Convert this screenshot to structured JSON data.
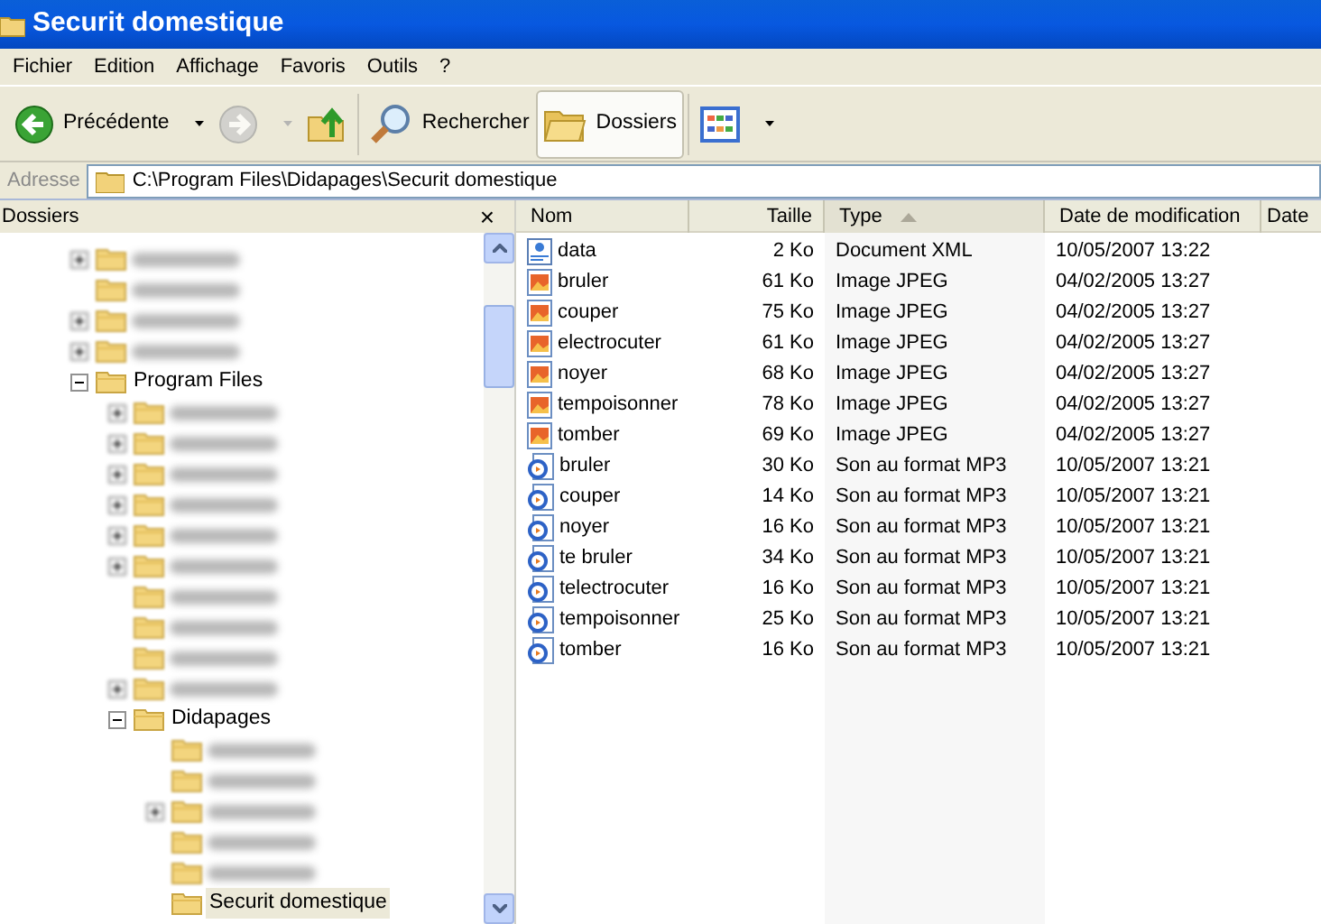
{
  "window": {
    "title": "Securit domestique"
  },
  "menu": [
    "Fichier",
    "Edition",
    "Affichage",
    "Favoris",
    "Outils",
    "?"
  ],
  "toolbar": [
    {
      "kind": "back",
      "label": "Précédente",
      "disabled": false
    },
    {
      "kind": "forward",
      "disabled": true
    },
    {
      "kind": "up"
    },
    {
      "kind": "search",
      "label": "Rechercher",
      "selected": false
    },
    {
      "kind": "folders",
      "label": "Dossiers",
      "selected": true
    },
    {
      "kind": "views"
    }
  ],
  "address": {
    "label": "Adresse",
    "value": "C:\\Program Files\\Didapages\\Securit domestique"
  },
  "folders_pane": {
    "title": "Dossiers",
    "close": "×"
  },
  "tree": [
    {
      "redacted": true,
      "expandable": true,
      "expanded": false,
      "selected": false
    },
    {
      "redacted": true,
      "expandable": false,
      "expanded": false,
      "selected": false
    },
    {
      "redacted": true,
      "expandable": true,
      "expanded": false,
      "selected": false
    },
    {
      "redacted": true,
      "expandable": true,
      "expanded": false,
      "selected": false
    },
    {
      "label": "Program Files",
      "expandable": true,
      "expanded": true,
      "selected": false,
      "children": [
        {
          "redacted": true,
          "expandable": true,
          "expanded": false,
          "selected": false
        },
        {
          "redacted": true,
          "expandable": true,
          "expanded": false,
          "selected": false
        },
        {
          "redacted": true,
          "expandable": true,
          "expanded": false,
          "selected": false
        },
        {
          "redacted": true,
          "expandable": true,
          "expanded": false,
          "selected": false
        },
        {
          "redacted": true,
          "expandable": true,
          "expanded": false,
          "selected": false
        },
        {
          "redacted": true,
          "expandable": true,
          "expanded": false,
          "selected": false
        },
        {
          "redacted": true,
          "expandable": false,
          "expanded": false,
          "selected": false
        },
        {
          "redacted": true,
          "expandable": false,
          "expanded": false,
          "selected": false
        },
        {
          "redacted": true,
          "expandable": false,
          "expanded": false,
          "selected": false
        },
        {
          "redacted": true,
          "expandable": true,
          "expanded": false,
          "selected": false
        },
        {
          "label": "Didapages",
          "expandable": true,
          "expanded": true,
          "selected": false,
          "children": [
            {
              "redacted": true,
              "expandable": false,
              "expanded": false,
              "selected": false
            },
            {
              "redacted": true,
              "expandable": false,
              "expanded": false,
              "selected": false
            },
            {
              "redacted": true,
              "expandable": true,
              "expanded": false,
              "selected": false
            },
            {
              "redacted": true,
              "expandable": false,
              "expanded": false,
              "selected": false
            },
            {
              "redacted": true,
              "expandable": false,
              "expanded": false,
              "selected": false
            },
            {
              "label": "Securit domestique",
              "expandable": false,
              "expanded": false,
              "selected": true
            }
          ]
        }
      ]
    }
  ],
  "file_list": {
    "columns": [
      {
        "label": "Nom",
        "sorted": false
      },
      {
        "label": "Taille",
        "sorted": false
      },
      {
        "label": "Type",
        "sorted": true
      },
      {
        "label": "Date de modification",
        "sorted": false
      },
      {
        "label": "Date",
        "sorted": false
      }
    ],
    "rows": [
      {
        "kind": "xml",
        "name": "data",
        "size": "2 Ko",
        "type": "Document XML",
        "modified": "10/05/2007 13:22"
      },
      {
        "kind": "jpeg",
        "name": "bruler",
        "size": "61 Ko",
        "type": "Image JPEG",
        "modified": "04/02/2005 13:27"
      },
      {
        "kind": "jpeg",
        "name": "couper",
        "size": "75 Ko",
        "type": "Image JPEG",
        "modified": "04/02/2005 13:27"
      },
      {
        "kind": "jpeg",
        "name": "electrocuter",
        "size": "61 Ko",
        "type": "Image JPEG",
        "modified": "04/02/2005 13:27"
      },
      {
        "kind": "jpeg",
        "name": "noyer",
        "size": "68 Ko",
        "type": "Image JPEG",
        "modified": "04/02/2005 13:27"
      },
      {
        "kind": "jpeg",
        "name": "tempoisonner",
        "size": "78 Ko",
        "type": "Image JPEG",
        "modified": "04/02/2005 13:27"
      },
      {
        "kind": "jpeg",
        "name": "tomber",
        "size": "69 Ko",
        "type": "Image JPEG",
        "modified": "04/02/2005 13:27"
      },
      {
        "kind": "mp3",
        "name": "bruler",
        "size": "30 Ko",
        "type": "Son au format MP3",
        "modified": "10/05/2007 13:21"
      },
      {
        "kind": "mp3",
        "name": "couper",
        "size": "14 Ko",
        "type": "Son au format MP3",
        "modified": "10/05/2007 13:21"
      },
      {
        "kind": "mp3",
        "name": "noyer",
        "size": "16 Ko",
        "type": "Son au format MP3",
        "modified": "10/05/2007 13:21"
      },
      {
        "kind": "mp3",
        "name": "te bruler",
        "size": "34 Ko",
        "type": "Son au format MP3",
        "modified": "10/05/2007 13:21"
      },
      {
        "kind": "mp3",
        "name": "telectrocuter",
        "size": "16 Ko",
        "type": "Son au format MP3",
        "modified": "10/05/2007 13:21"
      },
      {
        "kind": "mp3",
        "name": "tempoisonner",
        "size": "25 Ko",
        "type": "Son au format MP3",
        "modified": "10/05/2007 13:21"
      },
      {
        "kind": "mp3",
        "name": "tomber",
        "size": "16 Ko",
        "type": "Son au format MP3",
        "modified": "10/05/2007 13:21"
      }
    ]
  }
}
